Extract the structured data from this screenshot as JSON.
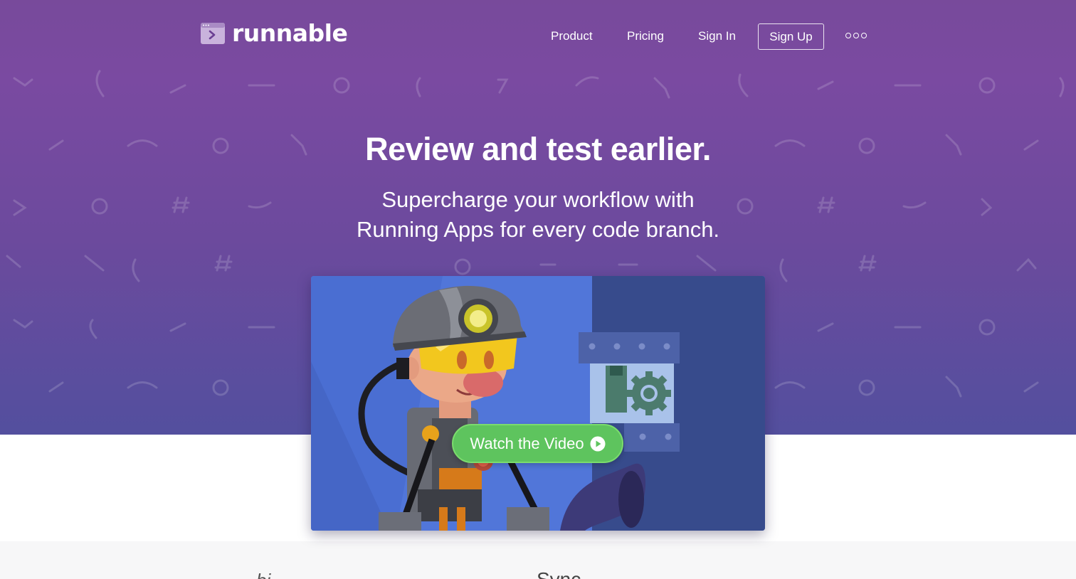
{
  "brand": {
    "name": "runnable"
  },
  "nav": {
    "items": [
      "Product",
      "Pricing",
      "Sign In"
    ],
    "signup_label": "Sign Up",
    "more_icon": "more-dots-icon"
  },
  "hero": {
    "headline": "Review and test earlier.",
    "subhead_line1": "Supercharge your workflow with",
    "subhead_line2": "Running Apps for every code branch.",
    "cta_label": "Watch the Video",
    "cta_icon": "play-circle-icon"
  },
  "below": {
    "peek_left": "bi...",
    "peek_right": "Sync..."
  },
  "colors": {
    "hero_top": "#784a9b",
    "hero_bottom": "#534f9e",
    "cta_green": "#5ec45e",
    "video_blue": "#5176d9"
  }
}
